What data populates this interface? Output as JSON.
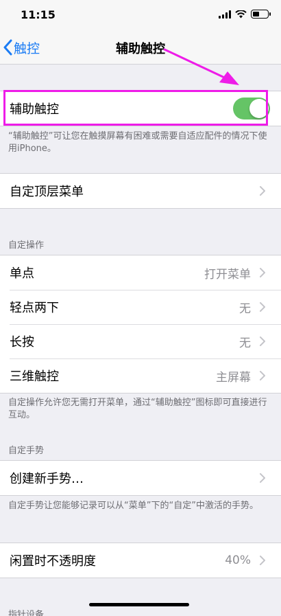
{
  "status_bar": {
    "time": "11:15",
    "battery_level": 0.45
  },
  "nav": {
    "back_label": "触控",
    "title": "辅助触控"
  },
  "assistive_touch": {
    "label": "辅助触控",
    "enabled": true,
    "footer": "“辅助触控”可让您在触摸屏幕有困难或需要自适应配件的情况下使用iPhone。"
  },
  "top_menu": {
    "label": "自定顶层菜单"
  },
  "custom_actions": {
    "header": "自定操作",
    "rows": [
      {
        "label": "单点",
        "value": "打开菜单"
      },
      {
        "label": "轻点两下",
        "value": "无"
      },
      {
        "label": "长按",
        "value": "无"
      },
      {
        "label": "三维触控",
        "value": "主屏幕"
      }
    ],
    "footer": "自定操作允许您无需打开菜单，通过“辅助触控”图标即可直接进行互动。"
  },
  "custom_gestures": {
    "header": "自定手势",
    "create_label": "创建新手势…",
    "footer": "自定手势让您能够记录可以从“菜单”下的“自定”中激活的手势。"
  },
  "idle_opacity": {
    "label": "闲置时不透明度",
    "value": "40%"
  },
  "partial_header": "指针设备",
  "colors": {
    "accent": "#1b7cf4",
    "toggle_on": "#65c466",
    "annotation": "#ee1ce8"
  },
  "icons": [
    "chevron-left-icon",
    "chevron-right-icon",
    "signal-icon",
    "wifi-icon",
    "battery-icon",
    "annotation-arrow-icon"
  ]
}
